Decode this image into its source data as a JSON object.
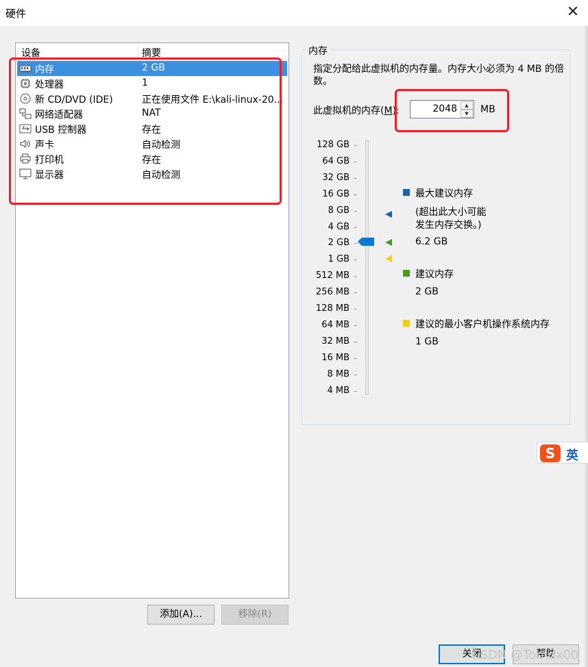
{
  "window": {
    "title": "硬件",
    "close_glyph": "✕"
  },
  "device_list": {
    "col_device": "设备",
    "col_summary": "摘要",
    "items": [
      {
        "name": "内存",
        "summary": "2 GB",
        "icon": "memory-icon",
        "selected": true
      },
      {
        "name": "处理器",
        "summary": "1",
        "icon": "processor-icon",
        "selected": false
      },
      {
        "name": "新 CD/DVD (IDE)",
        "summary": "正在使用文件 E:\\kali-linux-20...",
        "icon": "cd-dvd-icon",
        "selected": false
      },
      {
        "name": "网络适配器",
        "summary": "NAT",
        "icon": "network-adapter-icon",
        "selected": false
      },
      {
        "name": "USB 控制器",
        "summary": "存在",
        "icon": "usb-icon",
        "selected": false
      },
      {
        "name": "声卡",
        "summary": "自动检测",
        "icon": "speaker-icon",
        "selected": false
      },
      {
        "name": "打印机",
        "summary": "存在",
        "icon": "printer-icon",
        "selected": false
      },
      {
        "name": "显示器",
        "summary": "自动检测",
        "icon": "monitor-icon",
        "selected": false
      }
    ]
  },
  "buttons": {
    "add": "添加(A)...",
    "remove": "移除(R)",
    "close": "关闭",
    "help": "帮助"
  },
  "memory": {
    "group_label": "内存",
    "description": "指定分配给此虚拟机的内存量。内存大小必须为 4 MB 的倍数。",
    "field_label_prefix": "此虚拟机的内存(",
    "field_label_key": "M",
    "field_label_suffix": "):",
    "value": "2048",
    "unit": "MB",
    "current_level": "2 GB",
    "scale": [
      "128 GB",
      "64 GB",
      "32 GB",
      "16 GB",
      "8 GB",
      "4 GB",
      "2 GB",
      "1 GB",
      "512 MB",
      "256 MB",
      "128 MB",
      "64 MB",
      "32 MB",
      "16 MB",
      "8 MB",
      "4 MB"
    ],
    "legend": {
      "max_label": "最大建议内存",
      "max_note_line1": "(超出此大小可能",
      "max_note_line2": "发生内存交换。)",
      "max_value": "6.2 GB",
      "recommended_label": "建议内存",
      "recommended_value": "2 GB",
      "min_label": "建议的最小客户机操作系统内存",
      "min_value": "1 GB"
    },
    "colors": {
      "max": "#1a63a8",
      "recommended": "#4a9a1e",
      "min": "#f2d000",
      "slider": "#0a78d4"
    }
  },
  "ime": {
    "logo": "S",
    "mode": "英"
  },
  "watermark": "CSDN @Tomdx00"
}
